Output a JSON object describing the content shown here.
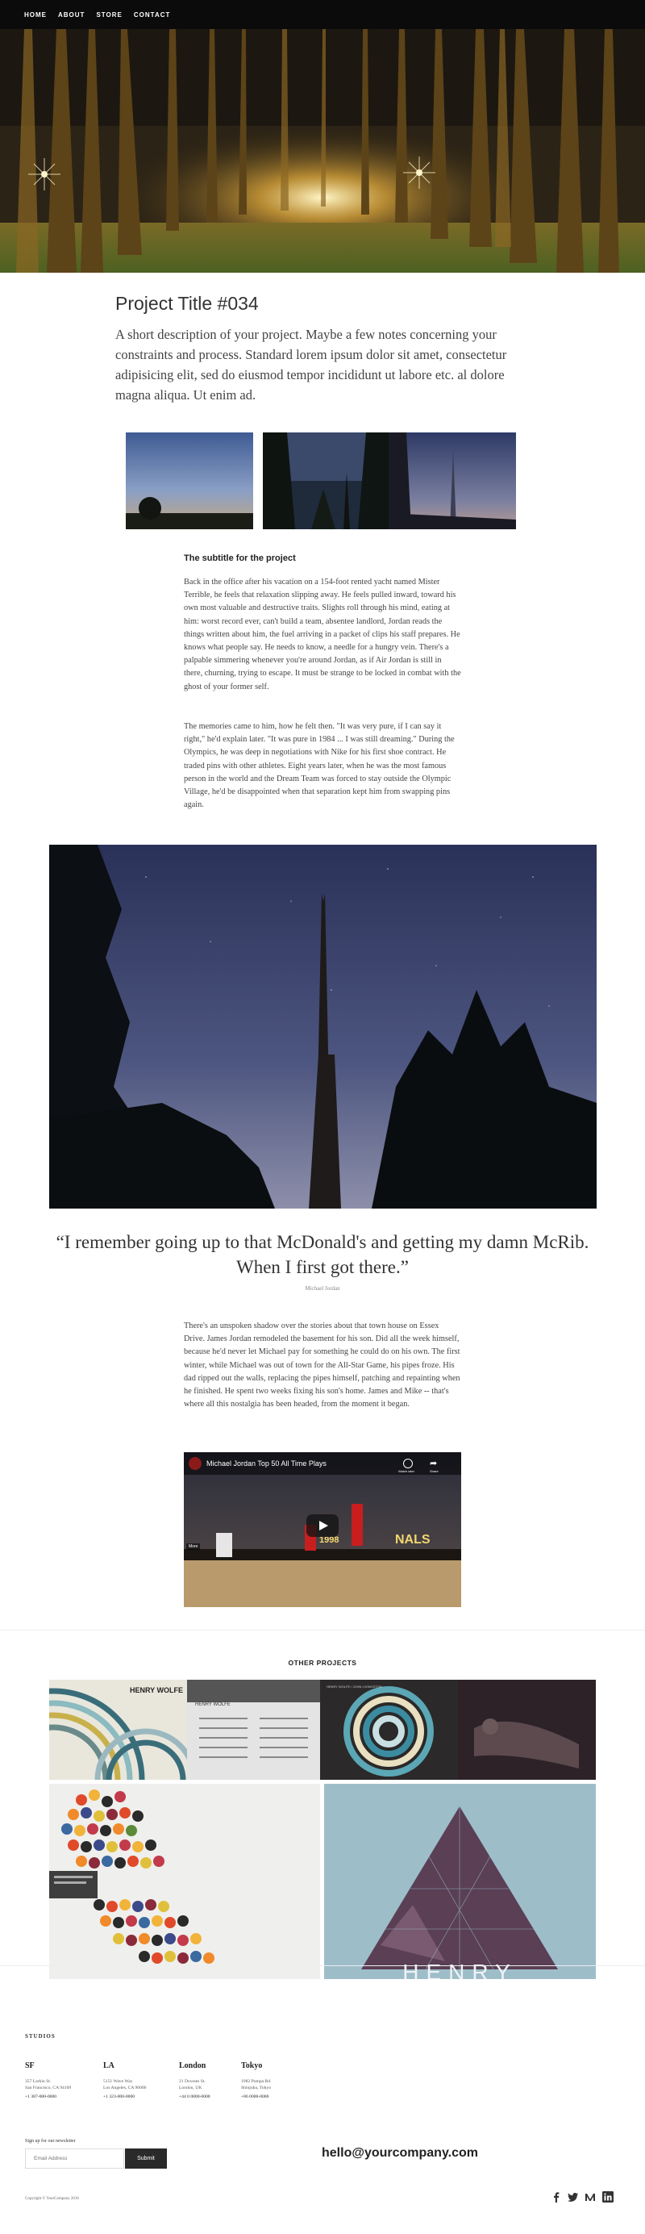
{
  "nav": {
    "items": [
      "Home",
      "About",
      "Store",
      "Contact"
    ]
  },
  "project": {
    "title": "Project Title #034",
    "lede": "A short description of your project. Maybe a few notes concerning your constraints and process. Standard lorem ipsum dolor sit amet, consectetur adipisicing elit, sed do eiusmod tempor incididunt ut labore etc. al dolore magna aliqua. Ut enim ad.",
    "subtitle": "The subtitle for the project",
    "para1": "Back in the office after his vacation on a 154-foot rented yacht named Mister Terrible, he feels that relaxation slipping away. He feels pulled inward, toward his own most valuable and destructive traits. Slights roll through his mind, eating at him: worst record ever, can't build a team, absentee landlord, Jordan reads the things written about him, the fuel arriving in a packet of clips his staff prepares. He knows what people say. He needs to know, a needle for a hungry vein. There's a palpable simmering whenever you're around Jordan, as if Air Jordan is still in there, churning, trying to escape. It must be strange to be locked in combat with the ghost of your former self.",
    "para2": "The memories came to him, how he felt then. \"It was very pure, if I can say it right,\" he'd explain later. \"It was pure in 1984 ... I was still dreaming.\" During the Olympics, he was deep in negotiations with Nike for his first shoe contract. He traded pins with other athletes. Eight years later, when he was the most famous person in the world and the Dream Team was forced to stay outside the Olympic Village, he'd be disappointed when that separation kept him from swapping pins again.",
    "quote": "“I remember going up to that McDonald's and getting my damn McRib. When I first got there.”",
    "quote_author": "Michael Jordan",
    "para3": "There's an unspoken shadow over the stories about that town house on Essex Drive. James Jordan remodeled the basement for his son. Did all the week himself, because he'd never let Michael pay for something he could do on his own. The first winter, while Michael was out of town for the All-Star Game, his pipes froze. His dad ripped out the walls, replacing the pipes himself, patching and repainting when he finished. He spent two weeks fixing his son's home. James and Mike -- that's where all this nostalgia has been headed, from the moment it began.",
    "video_title": "Michael Jordan Top 50 All Time Plays",
    "video_overlay": "NALS",
    "video_overlay2": "1998",
    "video_more_label": "More",
    "video_watch_label": "Watch later",
    "video_share_label": "Share"
  },
  "other_projects": {
    "title": "OTHER PROJECTS",
    "brand": "HENRY WOLFE",
    "tile3_caption": "HENRY WOLFE / JOHN LIVINGSTON"
  },
  "footer": {
    "studios_title": "STUDIOS",
    "cities": [
      {
        "name": "SF",
        "addr1": "357 Larkin St.",
        "addr2": "San Francisco, CA 94109",
        "phone": "+1 387-000-0000"
      },
      {
        "name": "LA",
        "addr1": "5151 Wave Way",
        "addr2": "Los Angeles, CA 90000",
        "phone": "+1 323-000-0000"
      },
      {
        "name": "London",
        "addr1": "21 Downes St.",
        "addr2": "London, UK",
        "phone": "+44 0 0000-0000"
      },
      {
        "name": "Tokyo",
        "addr1": "1982 Pumpa Rd.",
        "addr2": "Shinjuku, Tokyo",
        "phone": "+86 0000-0000"
      }
    ],
    "signup_label": "Sign up for our newsletter",
    "email_placeholder": "Email Address",
    "submit_label": "Submit",
    "contact_email": "hello@yourcompany.com",
    "copyright": "Copyright © YourCompany 2016"
  },
  "icons": [
    "facebook-icon",
    "twitter-icon",
    "medium-icon",
    "linkedin-icon"
  ]
}
